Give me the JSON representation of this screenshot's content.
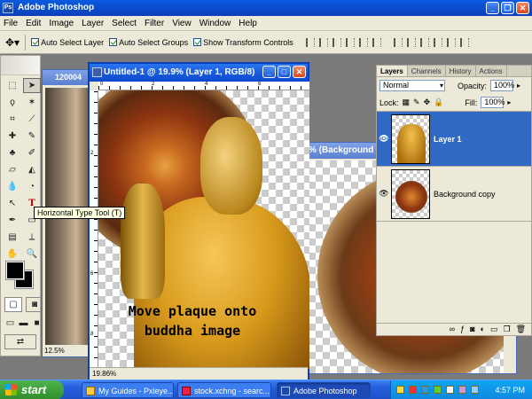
{
  "app": {
    "title": "Adobe Photoshop"
  },
  "menu": [
    "File",
    "Edit",
    "Image",
    "Layer",
    "Select",
    "Filter",
    "View",
    "Window",
    "Help"
  ],
  "options": {
    "auto_select_layer": "Auto Select Layer",
    "auto_select_groups": "Auto Select Groups",
    "show_transform": "Show Transform Controls"
  },
  "tooltip": "Horizontal Type Tool (T)",
  "doc_back": {
    "title": "120004",
    "zoom": "12.5%"
  },
  "doc_right": {
    "title": "% (Background"
  },
  "doc_main": {
    "title": "Untitled-1 @ 19.9% (Layer 1, RGB/8)",
    "zoom": "19.86%",
    "overlay_line1": "Move plaque onto",
    "overlay_line2": "buddha image",
    "ruler_top": [
      "0",
      "2",
      "4",
      "6"
    ],
    "ruler_left": [
      "2",
      "4",
      "6",
      "8"
    ]
  },
  "layers_panel": {
    "tabs": [
      "Layers",
      "Channels",
      "History",
      "Actions"
    ],
    "blend_mode": "Normal",
    "opacity_label": "Opacity:",
    "opacity": "100%",
    "lock_label": "Lock:",
    "fill_label": "Fill:",
    "fill": "100%",
    "layers": [
      {
        "name": "Layer 1"
      },
      {
        "name": "Background copy"
      }
    ]
  },
  "taskbar": {
    "start": "start",
    "items": [
      "My Guides - Pxleye...",
      "stock.xchng - searc...",
      "Adobe Photoshop"
    ],
    "clock": "4:57 PM"
  }
}
